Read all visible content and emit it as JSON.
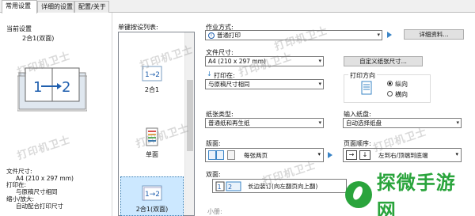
{
  "tabs": [
    "常用设置",
    "详细的设置",
    "配置/关于"
  ],
  "current": {
    "title": "当前设置",
    "name": "2合1(双面)",
    "info": [
      "文件尺寸:",
      "A4 (210 x 297 mm)",
      "打印在:",
      "与原稿尺寸相同",
      "缩小/放大:",
      "自动配合打印尺寸"
    ]
  },
  "presets": {
    "label": "单键按设列表:",
    "items": [
      "2合1",
      "单面",
      "2合1(双面)"
    ]
  },
  "job_mode": {
    "label": "作业方式:",
    "value": "普通打印",
    "detail_button": "详细资料..."
  },
  "file_size": {
    "label": "文件尺寸:",
    "value": "A4 (210 x 297 mm)",
    "custom_button": "自定义纸张尺寸..."
  },
  "print_on": {
    "label": "打印在:",
    "value": "与原稿尺寸相同"
  },
  "orientation": {
    "label": "打印方向",
    "portrait": "纵向",
    "landscape": "横向"
  },
  "paper_type": {
    "label": "纸张类型:",
    "value": "普通纸和再生纸"
  },
  "input_tray": {
    "label": "输入纸盘:",
    "value": "自动选择纸盘"
  },
  "layout": {
    "label": "版面:",
    "value": "每张两页"
  },
  "page_order": {
    "label": "页面顺序:",
    "value": "左到右/顶端到底端"
  },
  "duplex": {
    "label": "双面:",
    "value": "长边装订(向左翻页向上翻)"
  },
  "booklet": {
    "label": "小册:"
  },
  "watermark": {
    "text": "打印机卫士"
  },
  "logo": {
    "text": "探微手游网"
  }
}
